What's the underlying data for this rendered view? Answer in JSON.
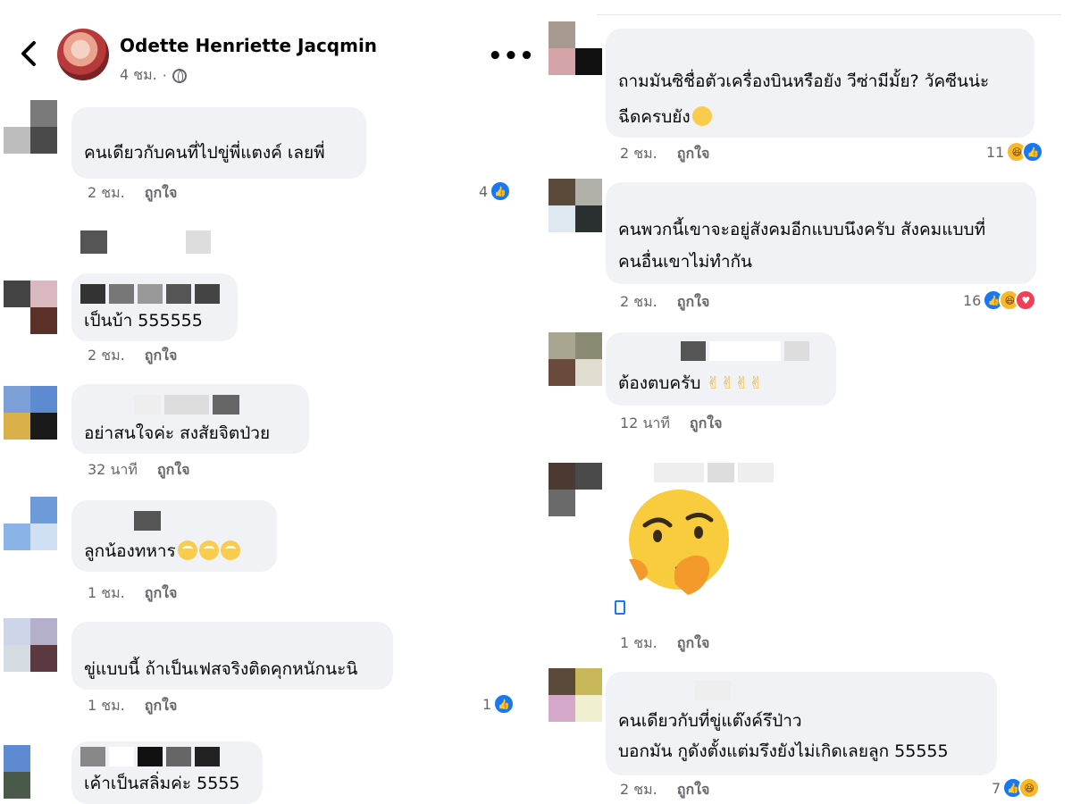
{
  "header": {
    "name": "Odette Henriette Jacqmin",
    "time": "4 ชม.",
    "more": "•••"
  },
  "left_comments": [
    {
      "text": "คนเดียวกับคนที่ไปขู่พี่แตงค์ เลยพี่",
      "time": "2 ชม.",
      "like": "ถูกใจ",
      "reactions": "4"
    },
    {
      "text": "เป็นบ้า 555555",
      "time": "2 ชม.",
      "like": "ถูกใจ"
    },
    {
      "text": "อย่าสนใจค่ะ สงสัยจิตป่วย",
      "time": "32 นาที",
      "like": "ถูกใจ"
    },
    {
      "text": "ลูกน้องทหาร",
      "time": "1 ชม.",
      "like": "ถูกใจ"
    },
    {
      "text": "ขู่แบบนี้ ถ้าเป็นเฟสจริงติดคุกหนักนะนิ",
      "time": "1 ชม.",
      "like": "ถูกใจ",
      "reactions": "1"
    },
    {
      "text": "เค้าเป็นสลิ่มค่ะ 5555"
    }
  ],
  "right_comments": [
    {
      "line1": "ถามมันซิชื่อตัวเครื่องบินหรือยัง วีซ่ามีมั้ย? วัคซีนน่ะ",
      "line2": "ฉีดครบยัง",
      "time": "2 ชม.",
      "like": "ถูกใจ",
      "reactions": "11"
    },
    {
      "line1": "คนพวกนี้เขาจะอยู่สังคมอีกแบบนึงครับ สังคมแบบที่",
      "line2": "คนอื่นเขาไม่ทำกัน",
      "time": "2 ชม.",
      "like": "ถูกใจ",
      "reactions": "16"
    },
    {
      "text": "ต้องตบครับ",
      "time": "12 นาที",
      "like": "ถูกใจ"
    },
    {
      "time": "1 ชม.",
      "like": "ถูกใจ"
    },
    {
      "line1": "คนเดียวกับที่ขู่แต๊งค์รึป่าว",
      "line2": "บอกมัน กูดังตั้งแต่มรึงยังไม่เกิดเลยลูก 55555",
      "time": "2 ชม.",
      "like": "ถูกใจ",
      "reactions": "7"
    }
  ],
  "icons": {
    "back": "chevron-left-icon",
    "globe": "globe-icon",
    "more": "more-icon",
    "like": "like-reaction-icon",
    "haha": "haha-reaction-icon",
    "love": "love-reaction-icon",
    "peace": "victory-hand-icon",
    "roll": "rolling-eyes-emoji"
  },
  "colors": {
    "bubble": "#f0f2f5",
    "meta": "#65676b",
    "like": "#1877f2",
    "haha": "#f7b928",
    "love": "#f33e58"
  }
}
